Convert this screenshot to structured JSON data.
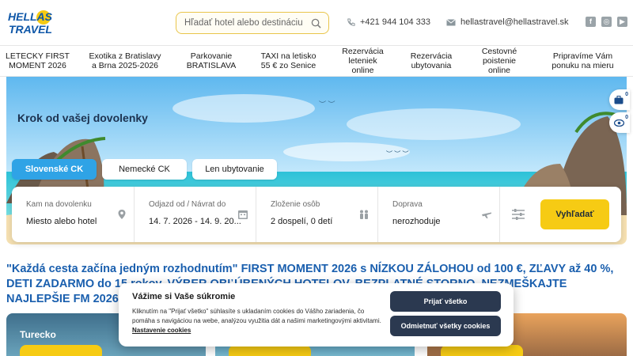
{
  "brand": {
    "line1": "HELLAS",
    "line2": "TRAVEL",
    "color": "#0f57a8",
    "accent": "#f6cb14"
  },
  "header": {
    "search": {
      "placeholder": "Hľadať hotel alebo destináciu..."
    },
    "phone": "+421 944 104 333",
    "email": "hellastravel@hellastravel.sk",
    "social": [
      "facebook-icon",
      "instagram-icon",
      "youtube-icon"
    ]
  },
  "nav": {
    "items": [
      {
        "label": "LETECKY FIRST\nMOMENT 2026"
      },
      {
        "label": "Exotika z Bratislavy\na Brna 2025-2026"
      },
      {
        "label": "Parkovanie\nBRATISLAVA"
      },
      {
        "label": "TAXI na letisko\n55 € zo Senice"
      },
      {
        "label": "Rezervácia\nleteniek\nonline"
      },
      {
        "label": "Rezervácia\nubytovania"
      },
      {
        "label": "Cestovné\npoistenie\nonline"
      },
      {
        "label": "Pripravíme Vám\nponuku na mieru"
      }
    ]
  },
  "hero": {
    "title": "Krok od vašej dovolenky",
    "tabs": [
      {
        "label": "Slovenské CK",
        "active": true
      },
      {
        "label": "Nemecké CK",
        "active": false
      },
      {
        "label": "Len ubytovanie",
        "active": false
      }
    ]
  },
  "search_panel": {
    "fields": [
      {
        "label": "Kam na dovolenku",
        "value": "Miesto alebo hotel",
        "icon": "map-pin-icon"
      },
      {
        "label": "Odjazd od / Návrat do",
        "value": "14. 7. 2026 - 14. 9. 20...",
        "icon": "calendar-icon"
      },
      {
        "label": "Zloženie osôb",
        "value": "2 dospelí, 0 detí",
        "icon": "people-icon"
      },
      {
        "label": "Doprava",
        "value": "nerozhoduje",
        "icon": "plane-icon"
      }
    ],
    "filter_icon": "sliders-icon",
    "button": "Vyhľadať"
  },
  "promo": "\"Každá cesta začína jedným rozhodnutím\" FIRST MOMENT 2026 s NÍZKOU ZÁLOHOU od 100 €, ZĽAVY až 40 %, DETI ZADARMO do 15 rokov, VÝBER OBĽÚBENÝCH HOTELOV, BEZPLATNÉ STORNO, NEZMEŠKAJTE NAJLEPŠIE FM 2026",
  "cards": [
    {
      "label": "Turecko"
    }
  ],
  "side_widgets": [
    {
      "icon": "suitcase-icon",
      "count": "0"
    },
    {
      "icon": "eye-icon",
      "count": "0"
    }
  ],
  "cookie": {
    "title": "Vážime si Vaše súkromie",
    "text": "Kliknutím na \"Prijať všetko\" súhlasíte s ukladaním cookies do Vášho zariadenia, čo pomáha s navigáciou na webe, analýzou využitia dát a našimi marketingovými aktivitami.",
    "link": "Nastavenie cookies",
    "accept": "Prijať všetko",
    "reject": "Odmietnuť všetky cookies"
  }
}
